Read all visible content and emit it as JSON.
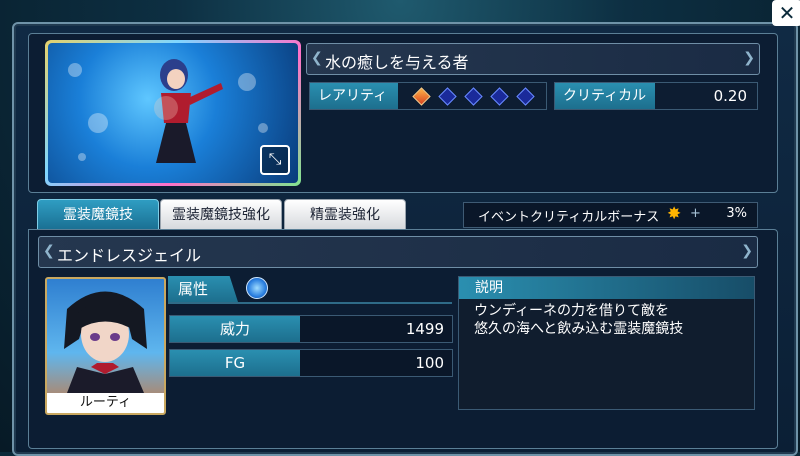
{
  "close_label": "✕",
  "card": {
    "title": "水の癒しを与える者",
    "rarity_label": "レアリティ",
    "rarity_filled": 1,
    "rarity_total": 5,
    "critical_label": "クリティカル",
    "critical_value": "0.20",
    "expand_icon": "expand-icon"
  },
  "tabs": [
    {
      "label": "霊装魔鏡技",
      "active": true
    },
    {
      "label": "霊装魔鏡技強化",
      "active": false
    },
    {
      "label": "精霊装強化",
      "active": false
    }
  ],
  "bonus": {
    "label": "イベントクリティカルボーナス",
    "plus": "+",
    "value": "3%"
  },
  "skill": {
    "name": "エンドレスジェイル",
    "character_name": "ルーティ",
    "attribute_label": "属性",
    "attribute_icon": "water-attribute-icon",
    "stats": [
      {
        "label": "威力",
        "value": "1499"
      },
      {
        "label": "FG",
        "value": "100"
      }
    ],
    "description_label": "説明",
    "description_lines": [
      "ウンディーネの力を借りて敵を",
      "悠久の海へと飲み込む霊装魔鏡技"
    ]
  },
  "colors": {
    "accent": "#2a8fb0",
    "frame": "#6f93a8",
    "rarity_orange": "#e86a2a",
    "rarity_blue": "#1a2a9a"
  }
}
